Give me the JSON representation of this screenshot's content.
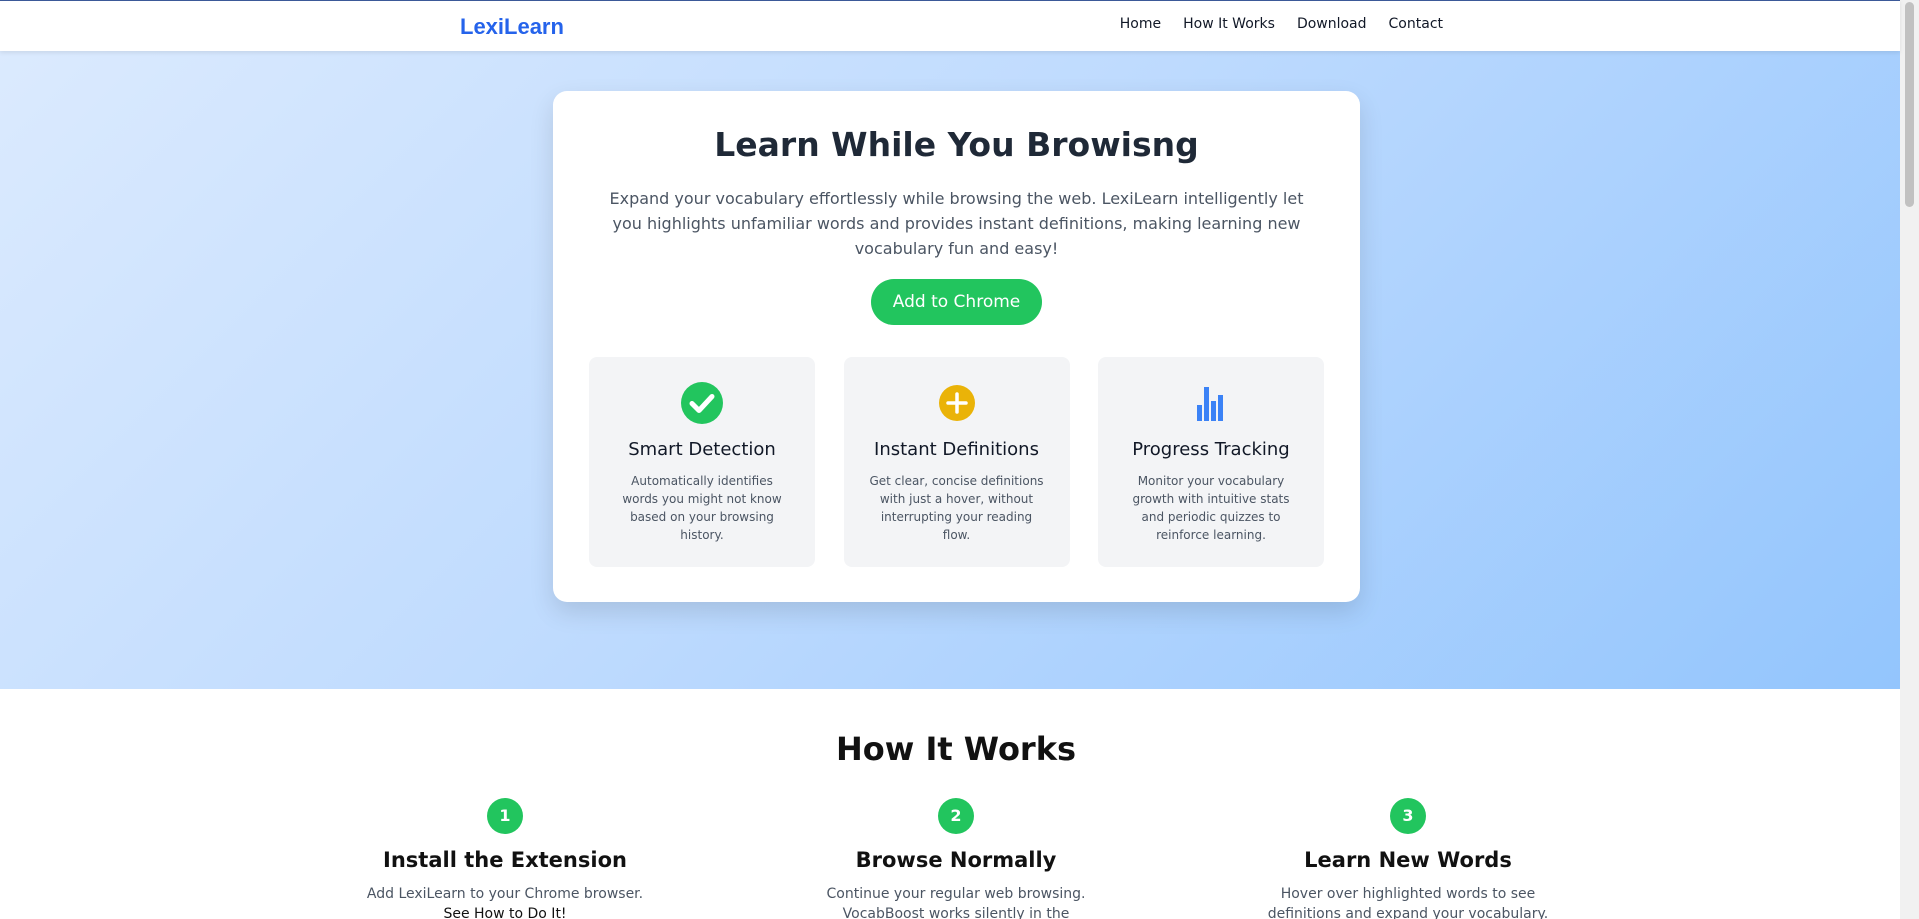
{
  "header": {
    "logo": "LexiLearn",
    "nav": [
      "Home",
      "How It Works",
      "Download",
      "Contact"
    ]
  },
  "hero": {
    "title": "Learn While You Browisng",
    "description": "Expand your vocabulary effortlessly while browsing the web. LexiLearn intelligently let you highlights unfamiliar words and provides instant definitions, making learning new vocabulary fun and easy!",
    "cta_label": "Add to Chrome"
  },
  "features": [
    {
      "icon": "check-circle-icon",
      "title": "Smart Detection",
      "text": "Automatically identifies words you might not know based on your browsing history."
    },
    {
      "icon": "plus-circle-icon",
      "title": "Instant Definitions",
      "text": "Get clear, concise definitions with just a hover, without interrupting your reading flow."
    },
    {
      "icon": "bar-chart-icon",
      "title": "Progress Tracking",
      "text": "Monitor your vocabulary growth with intuitive stats and periodic quizzes to reinforce learning."
    }
  ],
  "how_it_works": {
    "title": "How It Works",
    "steps": [
      {
        "number": "1",
        "title": "Install the Extension",
        "text": "Add LexiLearn to your Chrome browser.",
        "link": "See How to Do It!"
      },
      {
        "number": "2",
        "title": "Browse Normally",
        "text": "Continue your regular web browsing. VocabBoost works silently in the background."
      },
      {
        "number": "3",
        "title": "Learn New Words",
        "text": "Hover over highlighted words to see definitions and expand your vocabulary."
      }
    ]
  },
  "colors": {
    "brand": "#2563eb",
    "accent": "#22c55e",
    "warning": "#eab308",
    "chart": "#3b82f6"
  }
}
